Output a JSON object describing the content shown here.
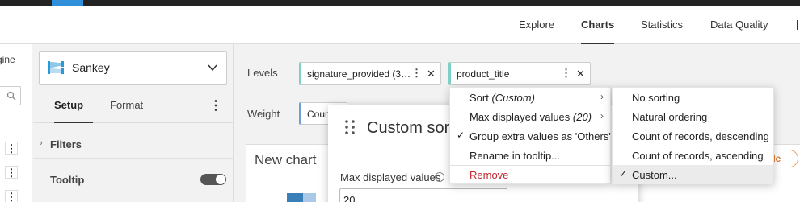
{
  "nav": {
    "tabs": [
      {
        "label": "Explore"
      },
      {
        "label": "Charts"
      },
      {
        "label": "Statistics"
      },
      {
        "label": "Data Quality"
      }
    ]
  },
  "left_strip": {
    "partial_label": "gine"
  },
  "sidebar": {
    "chart_type": "Sankey",
    "tabs": [
      {
        "label": "Setup"
      },
      {
        "label": "Format"
      }
    ],
    "filters_label": "Filters",
    "tooltip_label": "Tooltip",
    "tooltip_enabled": true
  },
  "config": {
    "levels_label": "Levels",
    "weight_label": "Weight",
    "level_pills": [
      {
        "text": "signature_provided (3…"
      },
      {
        "text": "product_title"
      }
    ],
    "weight_pill": {
      "text": "Coun"
    }
  },
  "chart": {
    "title": "New chart",
    "sample_badge": "ple"
  },
  "dialog": {
    "title": "Custom sor",
    "max_label": "Max displayed values",
    "max_value": "20"
  },
  "context_menu": {
    "items": [
      {
        "prefix": "Sort ",
        "italic": "(Custom)",
        "submenu": true,
        "checked": false
      },
      {
        "prefix": "Max displayed values ",
        "italic": "(20)",
        "submenu": true,
        "checked": false
      },
      {
        "prefix": "Group extra values as 'Others'",
        "italic": "",
        "submenu": false,
        "checked": true
      },
      {
        "prefix": "Rename in tooltip...",
        "italic": "",
        "submenu": false,
        "checked": false
      },
      {
        "prefix": "Remove",
        "italic": "",
        "submenu": false,
        "checked": false,
        "danger": true
      }
    ]
  },
  "sort_submenu": {
    "items": [
      {
        "label": "No sorting",
        "checked": false
      },
      {
        "label": "Natural ordering",
        "checked": false
      },
      {
        "label": "Count of records, descending",
        "checked": false
      },
      {
        "label": "Count of records, ascending",
        "checked": false
      },
      {
        "label": "Custom...",
        "checked": true
      }
    ]
  },
  "colors": {
    "accent": "#2f8fd8",
    "dimension_pill": "#7fcfc6",
    "measure_pill": "#6f9fd8",
    "danger": "#c4262e",
    "sample_badge": "#e07020"
  }
}
